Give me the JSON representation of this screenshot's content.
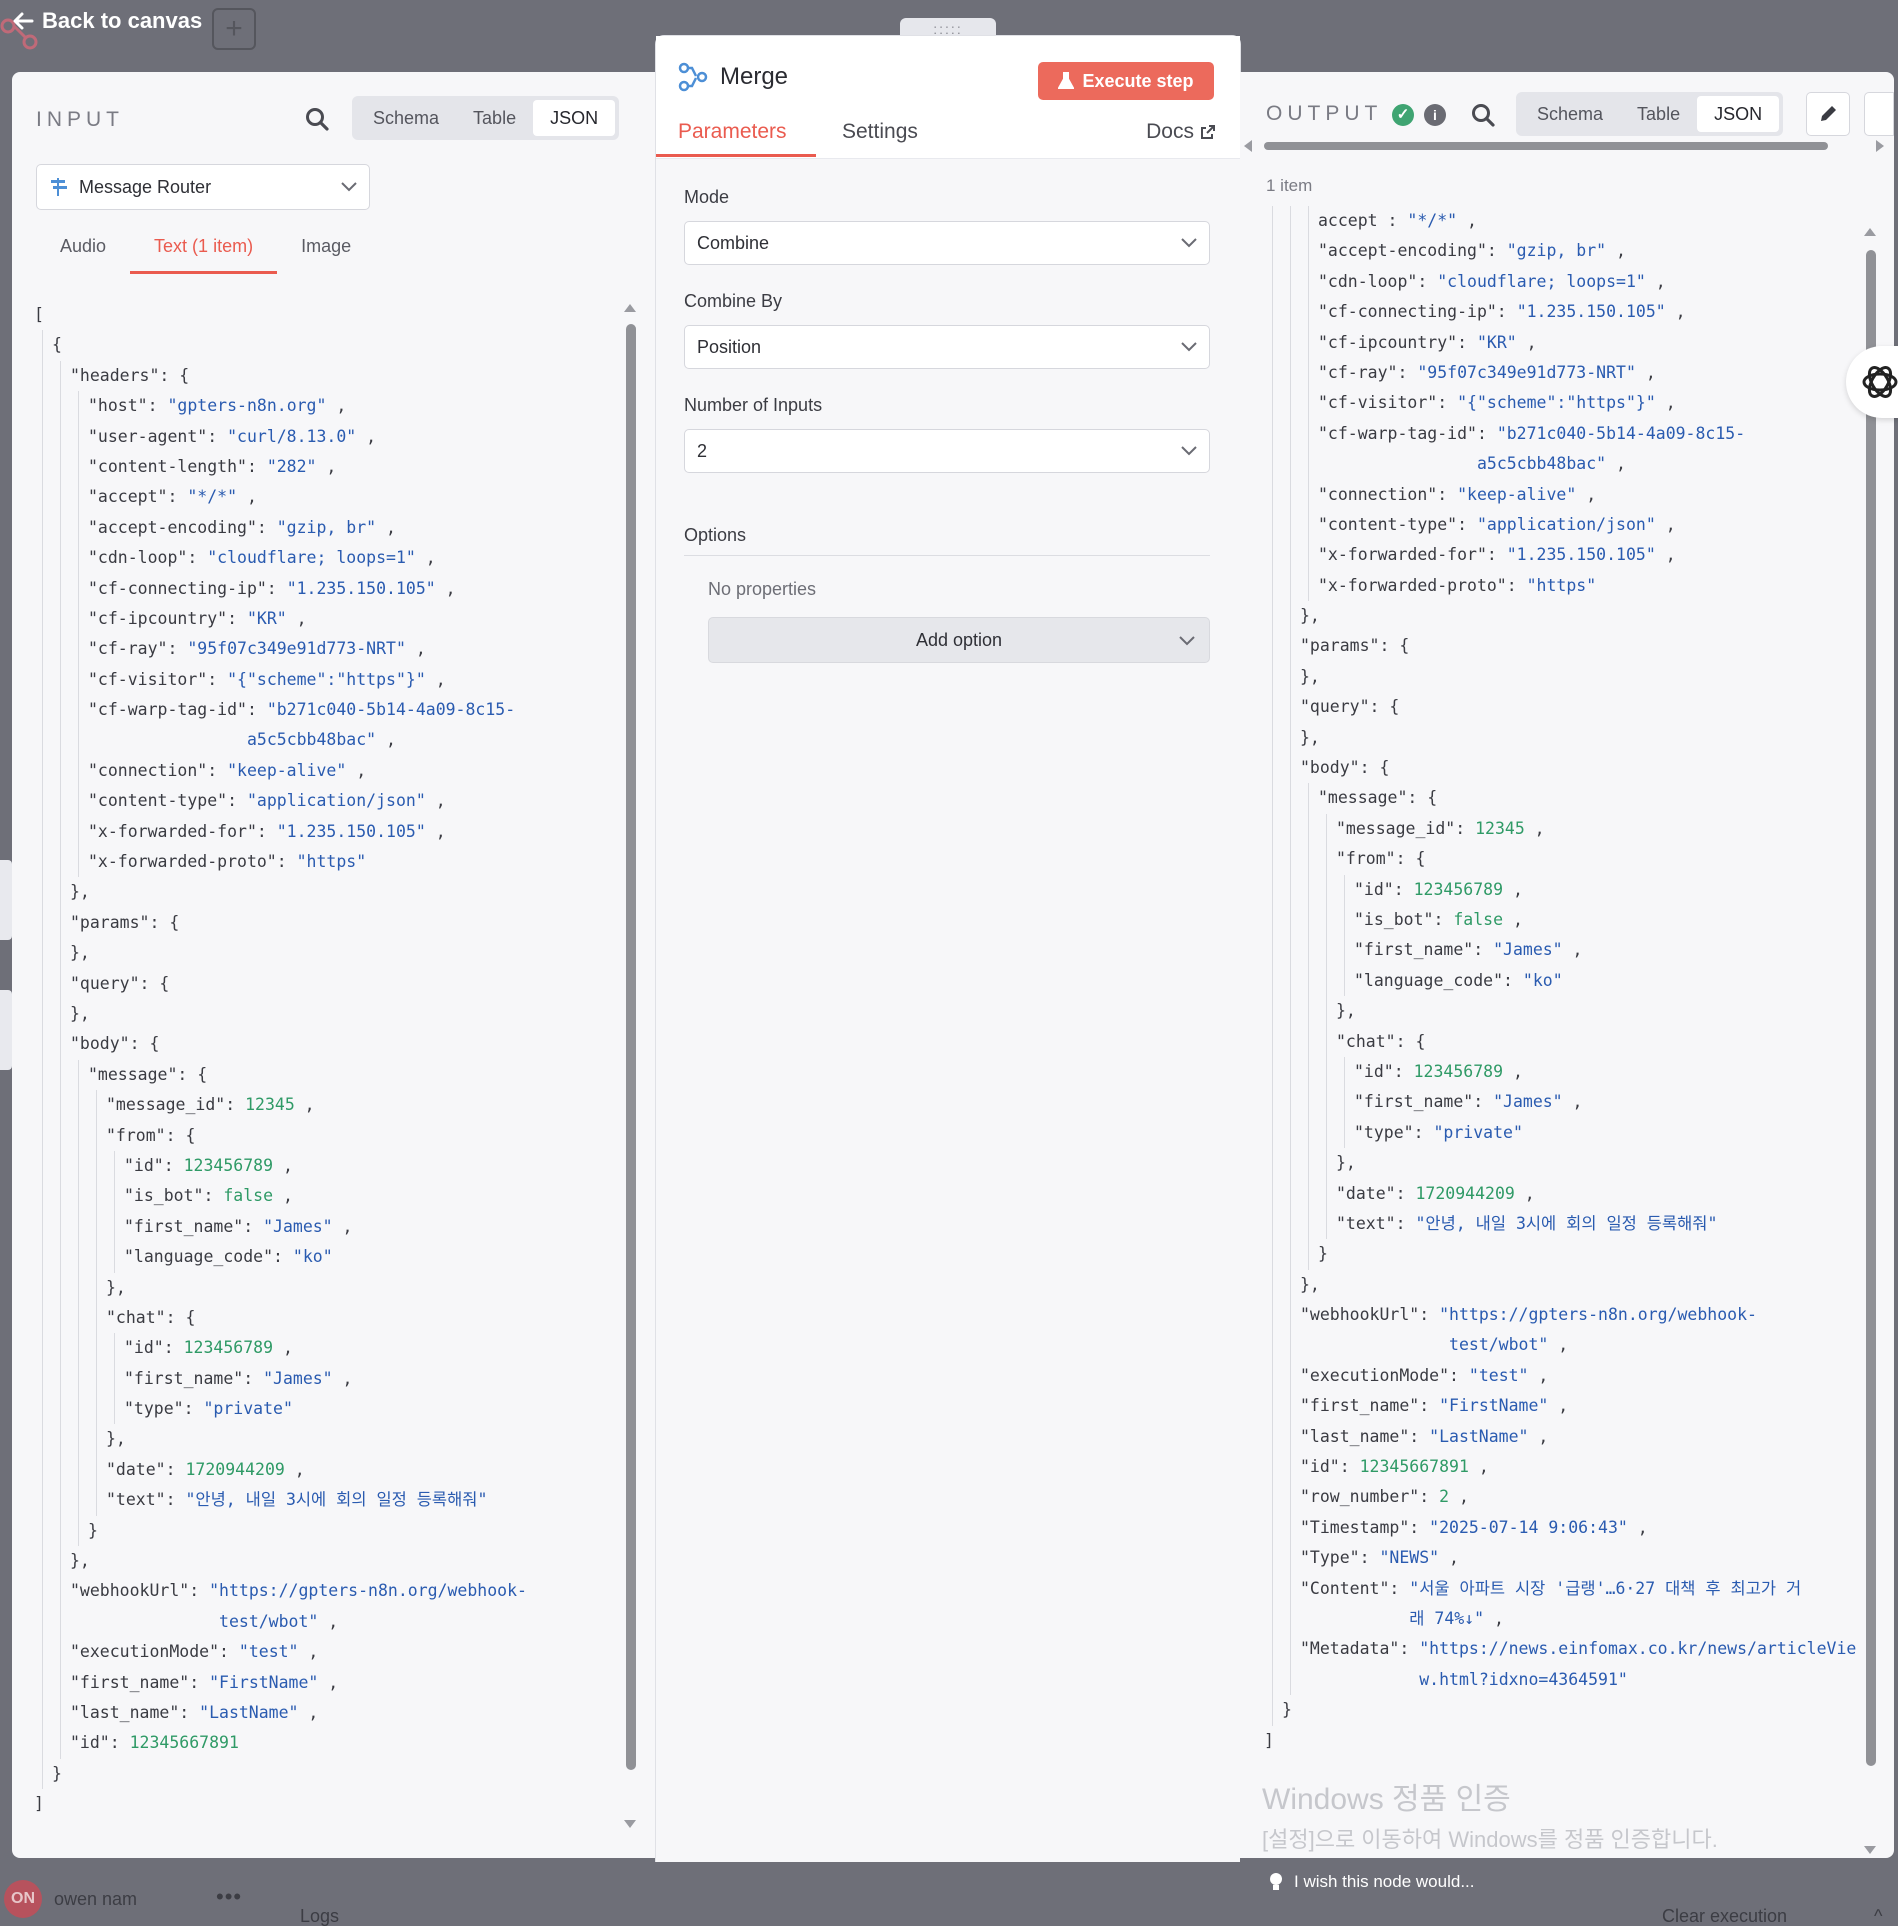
{
  "topbar": {
    "back_label": "Back to canvas",
    "add_label": "+"
  },
  "input": {
    "title": "INPUT",
    "view_tabs": [
      "Schema",
      "Table",
      "JSON"
    ],
    "active_view": "JSON",
    "node_name": "Message Router",
    "sub_tabs": [
      "Audio",
      "Text (1 item)",
      "Image"
    ],
    "active_sub_tab": "Text (1 item)"
  },
  "merge": {
    "title": "Merge",
    "execute_label": "Execute step",
    "tabs": {
      "parameters": "Parameters",
      "settings": "Settings",
      "docs": "Docs"
    },
    "mode_label": "Mode",
    "mode_value": "Combine",
    "combine_by_label": "Combine By",
    "combine_by_value": "Position",
    "inputs_label": "Number of Inputs",
    "inputs_value": "2",
    "options_label": "Options",
    "no_properties": "No properties",
    "add_option": "Add option"
  },
  "output": {
    "title": "OUTPUT",
    "view_tabs": [
      "Schema",
      "Table",
      "JSON"
    ],
    "active_view": "JSON",
    "item_count": "1 item",
    "wish_label": "I wish this node would..."
  },
  "activation": {
    "line1": "Windows 정품 인증",
    "line2": "[설정]으로 이동하여 Windows를 정품 인증합니다."
  },
  "footer": {
    "user_initials": "ON",
    "user_name": "owen nam",
    "more": "•••",
    "logs_label": "Logs",
    "clear_label": "Clear execution"
  },
  "colors": {
    "accent": "#ea5b4f",
    "execute_bg": "#ec6a5c",
    "json_string": "#2a5bb0",
    "json_number": "#2f9a66",
    "success": "#3fa472"
  },
  "input_json": [
    [
      0,
      "[",
      ""
    ],
    [
      1,
      "{",
      ""
    ],
    [
      2,
      "\"headers\": ",
      "{"
    ],
    [
      3,
      "\"host\": ",
      "s:\"gpters-n8n.org\"",
      ","
    ],
    [
      3,
      "\"user-agent\": ",
      "s:\"curl/8.13.0\"",
      ","
    ],
    [
      3,
      "\"content-length\": ",
      "s:\"282\"",
      ","
    ],
    [
      3,
      "\"accept\": ",
      "s:\"*/*\"",
      ","
    ],
    [
      3,
      "\"accept-encoding\": ",
      "s:\"gzip, br\"",
      ","
    ],
    [
      3,
      "\"cdn-loop\": ",
      "s:\"cloudflare; loops=1\"",
      ","
    ],
    [
      3,
      "\"cf-connecting-ip\": ",
      "s:\"1.235.150.105\"",
      ","
    ],
    [
      3,
      "\"cf-ipcountry\": ",
      "s:\"KR\"",
      ","
    ],
    [
      3,
      "\"cf-ray\": ",
      "s:\"95f07c349e91d773-NRT\"",
      ","
    ],
    [
      3,
      "\"cf-visitor\": ",
      "s:\"{\"scheme\":\"https\"}\"",
      ","
    ],
    [
      3,
      "\"cf-warp-tag-id\": ",
      "s:\"b271c040-5b14-4a09-8c15-",
      ""
    ],
    [
      3,
      "                ",
      "s:a5c5cbb48bac\"",
      ","
    ],
    [
      3,
      "\"connection\": ",
      "s:\"keep-alive\"",
      ","
    ],
    [
      3,
      "\"content-type\": ",
      "s:\"application/json\"",
      ","
    ],
    [
      3,
      "\"x-forwarded-for\": ",
      "s:\"1.235.150.105\"",
      ","
    ],
    [
      3,
      "\"x-forwarded-proto\": ",
      "s:\"https\"",
      ""
    ],
    [
      2,
      "},",
      ""
    ],
    [
      2,
      "\"params\": ",
      "{"
    ],
    [
      2,
      "},",
      ""
    ],
    [
      2,
      "\"query\": ",
      "{"
    ],
    [
      2,
      "},",
      ""
    ],
    [
      2,
      "\"body\": ",
      "{"
    ],
    [
      3,
      "\"message\": ",
      "{"
    ],
    [
      4,
      "\"message_id\": ",
      "n:12345",
      ","
    ],
    [
      4,
      "\"from\": ",
      "{"
    ],
    [
      5,
      "\"id\": ",
      "n:123456789",
      ","
    ],
    [
      5,
      "\"is_bot\": ",
      "n:false",
      ","
    ],
    [
      5,
      "\"first_name\": ",
      "s:\"James\"",
      ","
    ],
    [
      5,
      "\"language_code\": ",
      "s:\"ko\"",
      ""
    ],
    [
      4,
      "},",
      ""
    ],
    [
      4,
      "\"chat\": ",
      "{"
    ],
    [
      5,
      "\"id\": ",
      "n:123456789",
      ","
    ],
    [
      5,
      "\"first_name\": ",
      "s:\"James\"",
      ","
    ],
    [
      5,
      "\"type\": ",
      "s:\"private\"",
      ""
    ],
    [
      4,
      "},",
      ""
    ],
    [
      4,
      "\"date\": ",
      "n:1720944209",
      ","
    ],
    [
      4,
      "\"text\": ",
      "s:\"안녕, 내일 3시에 회의 일정 등록해줘\"",
      ""
    ],
    [
      3,
      "}",
      ""
    ],
    [
      2,
      "},",
      ""
    ],
    [
      2,
      "\"webhookUrl\": ",
      "s:\"https://gpters-n8n.org/webhook-",
      ""
    ],
    [
      2,
      "               ",
      "s:test/wbot\"",
      ","
    ],
    [
      2,
      "\"executionMode\": ",
      "s:\"test\"",
      ","
    ],
    [
      2,
      "\"first_name\": ",
      "s:\"FirstName\"",
      ","
    ],
    [
      2,
      "\"last_name\": ",
      "s:\"LastName\"",
      ","
    ],
    [
      2,
      "\"id\": ",
      "n:12345667891",
      ""
    ],
    [
      1,
      "}",
      ""
    ],
    [
      0,
      "]",
      ""
    ]
  ],
  "output_json": [
    [
      3,
      "accept : ",
      "s:\"*/*\"",
      ","
    ],
    [
      3,
      "\"accept-encoding\": ",
      "s:\"gzip, br\"",
      ","
    ],
    [
      3,
      "\"cdn-loop\": ",
      "s:\"cloudflare; loops=1\"",
      ","
    ],
    [
      3,
      "\"cf-connecting-ip\": ",
      "s:\"1.235.150.105\"",
      ","
    ],
    [
      3,
      "\"cf-ipcountry\": ",
      "s:\"KR\"",
      ","
    ],
    [
      3,
      "\"cf-ray\": ",
      "s:\"95f07c349e91d773-NRT\"",
      ","
    ],
    [
      3,
      "\"cf-visitor\": ",
      "s:\"{\"scheme\":\"https\"}\"",
      ","
    ],
    [
      3,
      "\"cf-warp-tag-id\": ",
      "s:\"b271c040-5b14-4a09-8c15-",
      ""
    ],
    [
      3,
      "                ",
      "s:a5c5cbb48bac\"",
      ","
    ],
    [
      3,
      "\"connection\": ",
      "s:\"keep-alive\"",
      ","
    ],
    [
      3,
      "\"content-type\": ",
      "s:\"application/json\"",
      ","
    ],
    [
      3,
      "\"x-forwarded-for\": ",
      "s:\"1.235.150.105\"",
      ","
    ],
    [
      3,
      "\"x-forwarded-proto\": ",
      "s:\"https\"",
      ""
    ],
    [
      2,
      "},",
      ""
    ],
    [
      2,
      "\"params\": ",
      "{"
    ],
    [
      2,
      "},",
      ""
    ],
    [
      2,
      "\"query\": ",
      "{"
    ],
    [
      2,
      "},",
      ""
    ],
    [
      2,
      "\"body\": ",
      "{"
    ],
    [
      3,
      "\"message\": ",
      "{"
    ],
    [
      4,
      "\"message_id\": ",
      "n:12345",
      ","
    ],
    [
      4,
      "\"from\": ",
      "{"
    ],
    [
      5,
      "\"id\": ",
      "n:123456789",
      ","
    ],
    [
      5,
      "\"is_bot\": ",
      "n:false",
      ","
    ],
    [
      5,
      "\"first_name\": ",
      "s:\"James\"",
      ","
    ],
    [
      5,
      "\"language_code\": ",
      "s:\"ko\"",
      ""
    ],
    [
      4,
      "},",
      ""
    ],
    [
      4,
      "\"chat\": ",
      "{"
    ],
    [
      5,
      "\"id\": ",
      "n:123456789",
      ","
    ],
    [
      5,
      "\"first_name\": ",
      "s:\"James\"",
      ","
    ],
    [
      5,
      "\"type\": ",
      "s:\"private\"",
      ""
    ],
    [
      4,
      "},",
      ""
    ],
    [
      4,
      "\"date\": ",
      "n:1720944209",
      ","
    ],
    [
      4,
      "\"text\": ",
      "s:\"안녕, 내일 3시에 회의 일정 등록해줘\"",
      ""
    ],
    [
      3,
      "}",
      ""
    ],
    [
      2,
      "},",
      ""
    ],
    [
      2,
      "\"webhookUrl\": ",
      "s:\"https://gpters-n8n.org/webhook-",
      ""
    ],
    [
      2,
      "               ",
      "s:test/wbot\"",
      ","
    ],
    [
      2,
      "\"executionMode\": ",
      "s:\"test\"",
      ","
    ],
    [
      2,
      "\"first_name\": ",
      "s:\"FirstName\"",
      ","
    ],
    [
      2,
      "\"last_name\": ",
      "s:\"LastName\"",
      ","
    ],
    [
      2,
      "\"id\": ",
      "n:12345667891",
      ","
    ],
    [
      2,
      "\"row_number\": ",
      "n:2",
      ","
    ],
    [
      2,
      "\"Timestamp\": ",
      "s:\"2025-07-14 9:06:43\"",
      ","
    ],
    [
      2,
      "\"Type\": ",
      "s:\"NEWS\"",
      ","
    ],
    [
      2,
      "\"Content\": ",
      "s:\"서울 아파트 시장 '급랭'…6·27 대책 후 최고가 거",
      ""
    ],
    [
      2,
      "           ",
      "s:래 74%↓\"",
      ","
    ],
    [
      2,
      "\"Metadata\": ",
      "s:\"https://news.einfomax.co.kr/news/articleVie",
      ""
    ],
    [
      2,
      "            ",
      "s:w.html?idxno=4364591\"",
      ""
    ],
    [
      1,
      "}",
      ""
    ],
    [
      0,
      "]",
      ""
    ]
  ]
}
